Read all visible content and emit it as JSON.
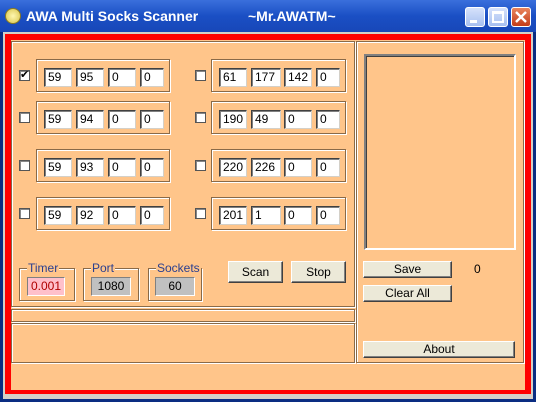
{
  "window": {
    "title": "AWA Multi Socks Scanner",
    "subtitle": "~Mr.AWATM~"
  },
  "ranges": [
    {
      "checked": true,
      "octets": [
        "59",
        "95",
        "0",
        "0"
      ]
    },
    {
      "checked": false,
      "octets": [
        "59",
        "94",
        "0",
        "0"
      ]
    },
    {
      "checked": false,
      "octets": [
        "59",
        "93",
        "0",
        "0"
      ]
    },
    {
      "checked": false,
      "octets": [
        "59",
        "92",
        "0",
        "0"
      ]
    },
    {
      "checked": false,
      "octets": [
        "61",
        "177",
        "142",
        "0"
      ]
    },
    {
      "checked": false,
      "octets": [
        "190",
        "49",
        "0",
        "0"
      ]
    },
    {
      "checked": false,
      "octets": [
        "220",
        "226",
        "0",
        "0"
      ]
    },
    {
      "checked": false,
      "octets": [
        "201",
        "1",
        "0",
        "0"
      ]
    }
  ],
  "settings": {
    "timer": {
      "label": "Timer",
      "value": "0.001"
    },
    "port": {
      "label": "Port",
      "value": "1080"
    },
    "sockets": {
      "label": "Sockets",
      "value": "60"
    }
  },
  "buttons": {
    "scan": "Scan",
    "stop": "Stop",
    "save": "Save",
    "clear_all": "Clear All",
    "about": "About"
  },
  "results": {
    "count": "0"
  },
  "colors": {
    "panel": "#ffc58a",
    "frame": "#ff0000",
    "timer_field": "#ffc0cb",
    "readonly_field": "#c0c0c0"
  }
}
